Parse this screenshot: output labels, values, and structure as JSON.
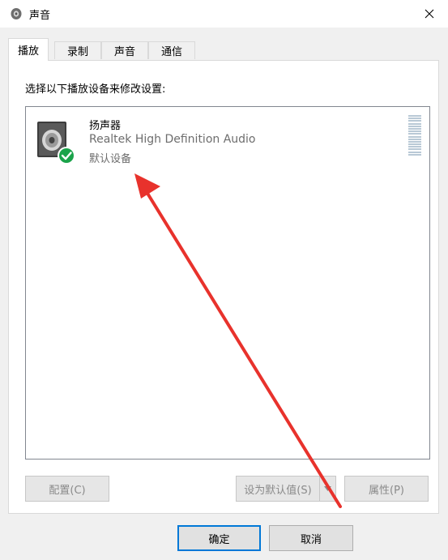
{
  "window": {
    "title": "声音"
  },
  "tabs": [
    {
      "label": "播放",
      "active": true
    },
    {
      "label": "录制",
      "active": false
    },
    {
      "label": "声音",
      "active": false
    },
    {
      "label": "通信",
      "active": false
    }
  ],
  "panel": {
    "instruction": "选择以下播放设备来修改设置:"
  },
  "device": {
    "name": "扬声器",
    "description": "Realtek High Definition Audio",
    "status": "默认设备",
    "status_icon": "green-check-icon"
  },
  "buttons": {
    "configure": "配置(C)",
    "set_default": "设为默认值(S)",
    "properties": "属性(P)",
    "ok": "确定",
    "cancel": "取消"
  },
  "colors": {
    "accent": "#0078d7",
    "check_green": "#1aa34a",
    "annotation_arrow": "#e8322c"
  }
}
